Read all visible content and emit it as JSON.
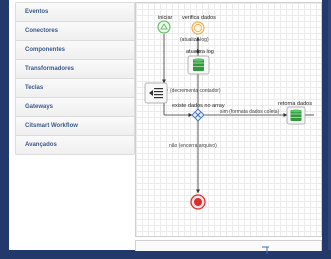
{
  "sidebar": {
    "items": [
      {
        "label": "Eventos"
      },
      {
        "label": "Conectores"
      },
      {
        "label": "Componentes"
      },
      {
        "label": "Transformadores"
      },
      {
        "label": "Teclas"
      },
      {
        "label": "Gateways"
      },
      {
        "label": "Citsmart Workflow"
      },
      {
        "label": "Avançados"
      }
    ]
  },
  "diagram": {
    "nodes": {
      "start": "iniciar",
      "verify": "verifica dados",
      "update_log": "atualiza log",
      "return_data": "retorna dados",
      "gateway": "existe dados no array"
    },
    "flows": {
      "update_log": "(atualiza log)",
      "decrement": "(decrementa contador)",
      "yes_format": "sim (formata dados coleta)",
      "no_end": "não (encerra arquivo)"
    }
  },
  "colors": {
    "background": "#23396b",
    "start_event": "#58b358",
    "verify_event": "#e8a33a",
    "task_icon": "#2e9a3c",
    "gateway": "#3d6fb5",
    "end_event": "#d9302f"
  }
}
